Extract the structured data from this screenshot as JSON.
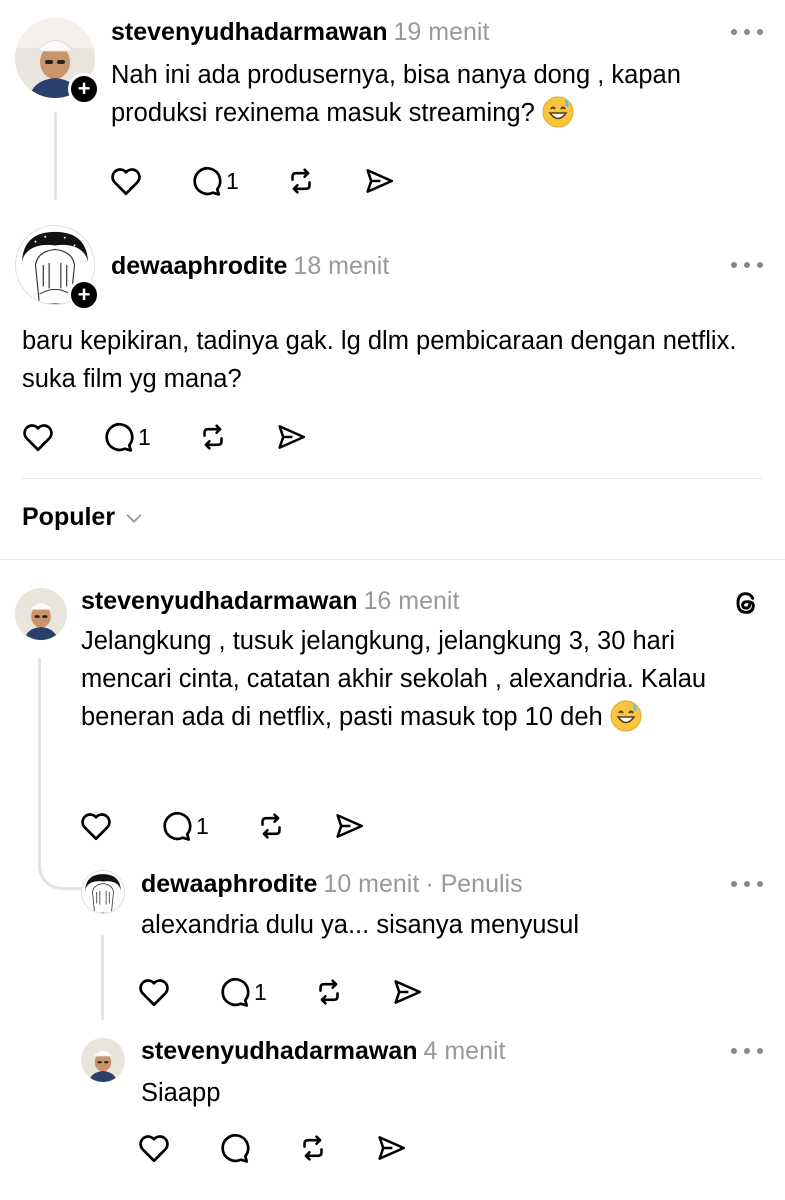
{
  "posts": [
    {
      "username": "stevenyudhadarmawan",
      "time": "19 menit",
      "text": "Nah ini ada produsernya, bisa nanya dong , kapan produksi rexinema  masuk streaming?",
      "emoji": "😅",
      "reply_count": "1",
      "avatar_icon": "profile-photo-avatar"
    },
    {
      "username": "dewaaphrodite",
      "time": "18 menit",
      "text": "baru kepikiran, tadinya gak. lg dlm pembicaraan dengan netflix. suka film yg mana?",
      "reply_count": "1",
      "avatar_icon": "illustration-avatar"
    }
  ],
  "sort": {
    "label": "Populer",
    "icon": "chevron-down-icon"
  },
  "replies": [
    {
      "username": "stevenyudhadarmawan",
      "time": "16 menit",
      "text": "Jelangkung , tusuk jelangkung, jelangkung 3, 30 hari mencari cinta, catatan akhir sekolah , alexandria. Kalau beneran ada di netflix, pasti masuk top 10 deh",
      "emoji": "😅",
      "reply_count": "1",
      "badge_icon": "threads-logo-icon"
    },
    {
      "username": "dewaaphrodite",
      "time": "10 menit",
      "role": "· Penulis",
      "text": "alexandria dulu ya... sisanya menyusul",
      "reply_count": "1"
    },
    {
      "username": "stevenyudhadarmawan",
      "time": "4 menit",
      "text": "Siaapp",
      "reply_count": ""
    }
  ],
  "colors": {
    "text": "#000000",
    "muted": "#999999",
    "thread_line": "#e4e4e4",
    "divider": "#e6e6e6"
  }
}
